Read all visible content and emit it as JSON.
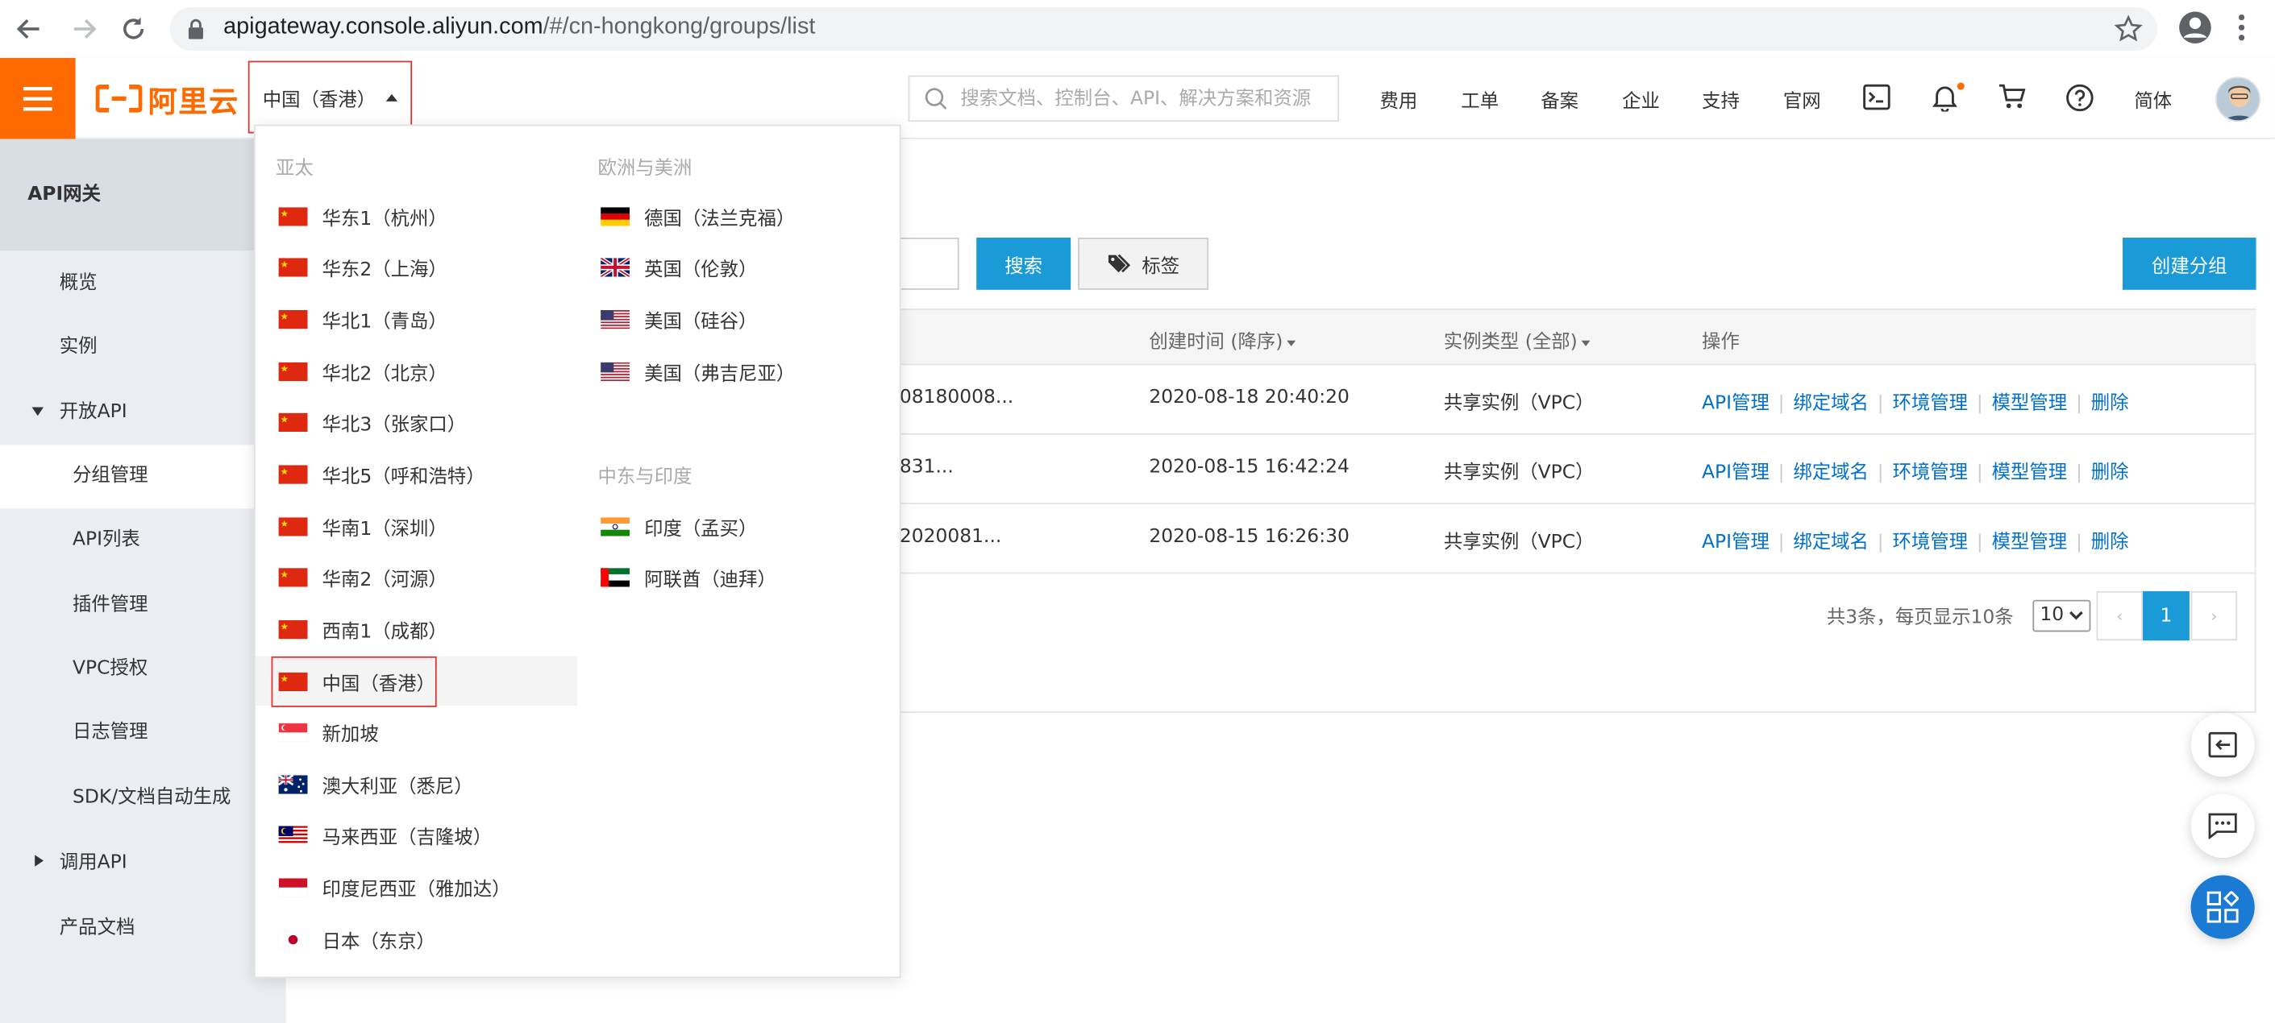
{
  "browser": {
    "url_host": "apigateway.console.aliyun.com",
    "url_path": "/#/cn-hongkong/groups/list"
  },
  "header": {
    "logo_text": "阿里云",
    "region_label": "中国（香港）",
    "search_placeholder": "搜索文档、控制台、API、解决方案和资源",
    "nav": [
      "费用",
      "工单",
      "备案",
      "企业",
      "支持",
      "官网"
    ],
    "lang": "简体"
  },
  "sidebar": {
    "title": "API网关",
    "items": [
      {
        "label": "概览"
      },
      {
        "label": "实例"
      },
      {
        "label": "开放API"
      },
      {
        "label": "分组管理"
      },
      {
        "label": "API列表"
      },
      {
        "label": "插件管理"
      },
      {
        "label": "VPC授权"
      },
      {
        "label": "日志管理"
      },
      {
        "label": "SDK/文档自动生成"
      },
      {
        "label": "调用API"
      },
      {
        "label": "产品文档"
      }
    ]
  },
  "main": {
    "search_button": "搜索",
    "tag_button": "标签",
    "create_button": "创建分组",
    "columns": {
      "created": "创建时间 (降序)",
      "instance": "实例类型 (全部)",
      "ops": "操作"
    },
    "rows": [
      {
        "id_fragment": "08180008...",
        "created": "2020-08-18 20:40:20",
        "instance": "共享实例（VPC）"
      },
      {
        "id_fragment": "831...",
        "created": "2020-08-15 16:42:24",
        "instance": "共享实例（VPC）"
      },
      {
        "id_fragment": "2020081...",
        "created": "2020-08-15 16:26:30",
        "instance": "共享实例（VPC）"
      }
    ],
    "op_links": [
      "API管理",
      "绑定域名",
      "环境管理",
      "模型管理",
      "删除"
    ],
    "pager": {
      "summary": "共3条，每页显示10条",
      "page_size": "10",
      "prev": "‹",
      "current": "1",
      "next": "›"
    }
  },
  "dropdown": {
    "groups": {
      "asia": "亚太",
      "euam": "欧洲与美洲",
      "mein": "中东与印度"
    },
    "asia_items": [
      "华东1（杭州）",
      "华东2（上海）",
      "华北1（青岛）",
      "华北2（北京）",
      "华北3（张家口）",
      "华北5（呼和浩特）",
      "华南1（深圳）",
      "华南2（河源）",
      "西南1（成都）",
      "中国（香港）",
      "新加坡",
      "澳大利亚（悉尼）",
      "马来西亚（吉隆坡）",
      "印度尼西亚（雅加达）",
      "日本（东京）"
    ],
    "euam_items": [
      "德国（法兰克福）",
      "英国（伦敦）",
      "美国（硅谷）",
      "美国（弗吉尼亚）"
    ],
    "mein_items": [
      "印度（孟买）",
      "阿联酋（迪拜）"
    ]
  },
  "colors": {
    "brand_orange": "#ff6a00",
    "primary_blue": "#1a9bd7",
    "link_blue": "#0070cc",
    "highlight_red": "#e3342f"
  }
}
